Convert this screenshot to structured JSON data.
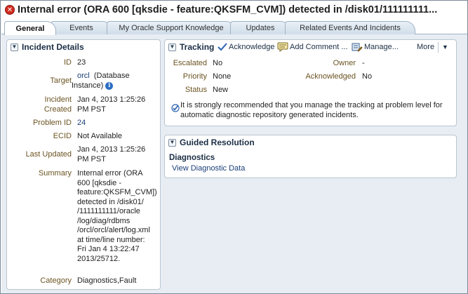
{
  "title": "Internal error (ORA 600 [qksdie - feature:QKSFM_CVM]) detected in /disk01/111111111...",
  "tabs": [
    {
      "label": "General"
    },
    {
      "label": "Events"
    },
    {
      "label": "My Oracle Support Knowledge"
    },
    {
      "label": "Updates"
    },
    {
      "label": "Related Events And Incidents"
    }
  ],
  "incident_details": {
    "title": "Incident Details",
    "id_label": "ID",
    "id_value": "23",
    "target_label": "Target",
    "target_value_1": "orcl",
    "target_value_2": "(Database",
    "target_value_3": "Instance)",
    "created_label_1": "Incident",
    "created_label_2": "Created",
    "created_value_1": "Jan 4, 2013 1:25:26",
    "created_value_2": "PM PST",
    "problem_label": "Problem ID",
    "problem_value": "24",
    "ecid_label": "ECID",
    "ecid_value": "Not Available",
    "updated_label": "Last Updated",
    "updated_value_1": "Jan 4, 2013 1:25:26",
    "updated_value_2": "PM PST",
    "summary_label": "Summary",
    "summary_lines": [
      "Internal error (ORA",
      "600 [qksdie -",
      "feature:QKSFM_CVM])",
      "detected in /disk01/",
      "/1111111111/oracle",
      "/log/diag/rdbms",
      "/orcl/orcl/alert/log.xml",
      "at time/line number:",
      "Fri Jan 4 13:22:47",
      "2013/25712."
    ],
    "category_label": "Category",
    "category_value": "Diagnostics,Fault"
  },
  "tracking": {
    "title": "Tracking",
    "acknowledge_label": "Acknowledge",
    "add_comment_label": "Add Comment ...",
    "manage_label": "Manage...",
    "more_label": "More",
    "escalated_label": "Escalated",
    "escalated_value": "No",
    "priority_label": "Priority",
    "priority_value": "None",
    "status_label": "Status",
    "status_value": "New",
    "owner_label": "Owner",
    "owner_value": "-",
    "acknowledged_label": "Acknowledged",
    "acknowledged_value": "No",
    "note_line_1": "It is strongly recommended that you manage the tracking at problem level for",
    "note_line_2": "automatic diagnostic repository generated incidents."
  },
  "guided_resolution": {
    "title": "Guided Resolution",
    "section_title": "Diagnostics",
    "link_label": "View Diagnostic Data"
  }
}
